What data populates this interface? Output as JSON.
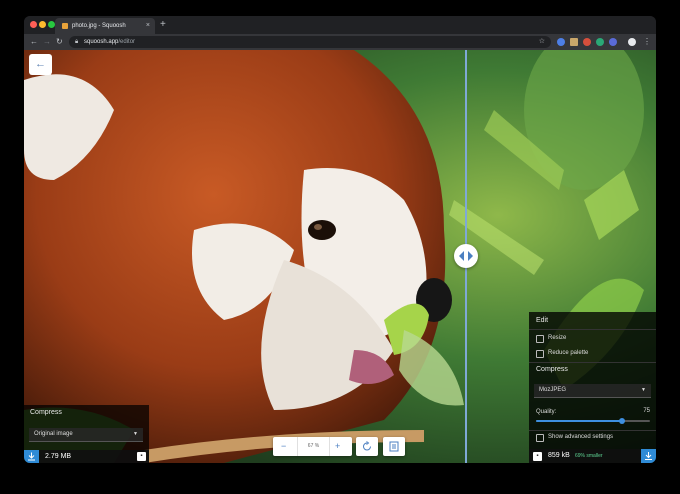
{
  "browser": {
    "tab_title": "photo.jpg - Squoosh",
    "tab_close": "×",
    "new_tab": "+",
    "url_host": "squoosh.app",
    "url_path": "/editor",
    "back": "←",
    "forward": "→",
    "reload": "↻"
  },
  "editor": {
    "back_label": "←",
    "left_panel": {
      "title": "Compress",
      "method": "Original image",
      "size": "2.79 MB"
    },
    "zoom": {
      "minus": "−",
      "value": "67 %",
      "plus": "+"
    },
    "right_panel": {
      "edit_title": "Edit",
      "resize_label": "Resize",
      "reduce_palette_label": "Reduce palette",
      "compress_title": "Compress",
      "encoder": "MozJPEG",
      "quality_label": "Quality:",
      "quality_value": "75",
      "quality": 75,
      "advanced_label": "Show advanced settings",
      "size": "859 kB",
      "savings": "69% smaller"
    }
  },
  "colors": {
    "accent": "#2f8bd6",
    "savings_green": "#5fd394",
    "divider_blue": "#7fa9d6"
  },
  "icons": {
    "download": "download-icon",
    "save": "save-icon",
    "rotate": "rotate-icon",
    "background_toggle": "background-toggle-icon"
  }
}
